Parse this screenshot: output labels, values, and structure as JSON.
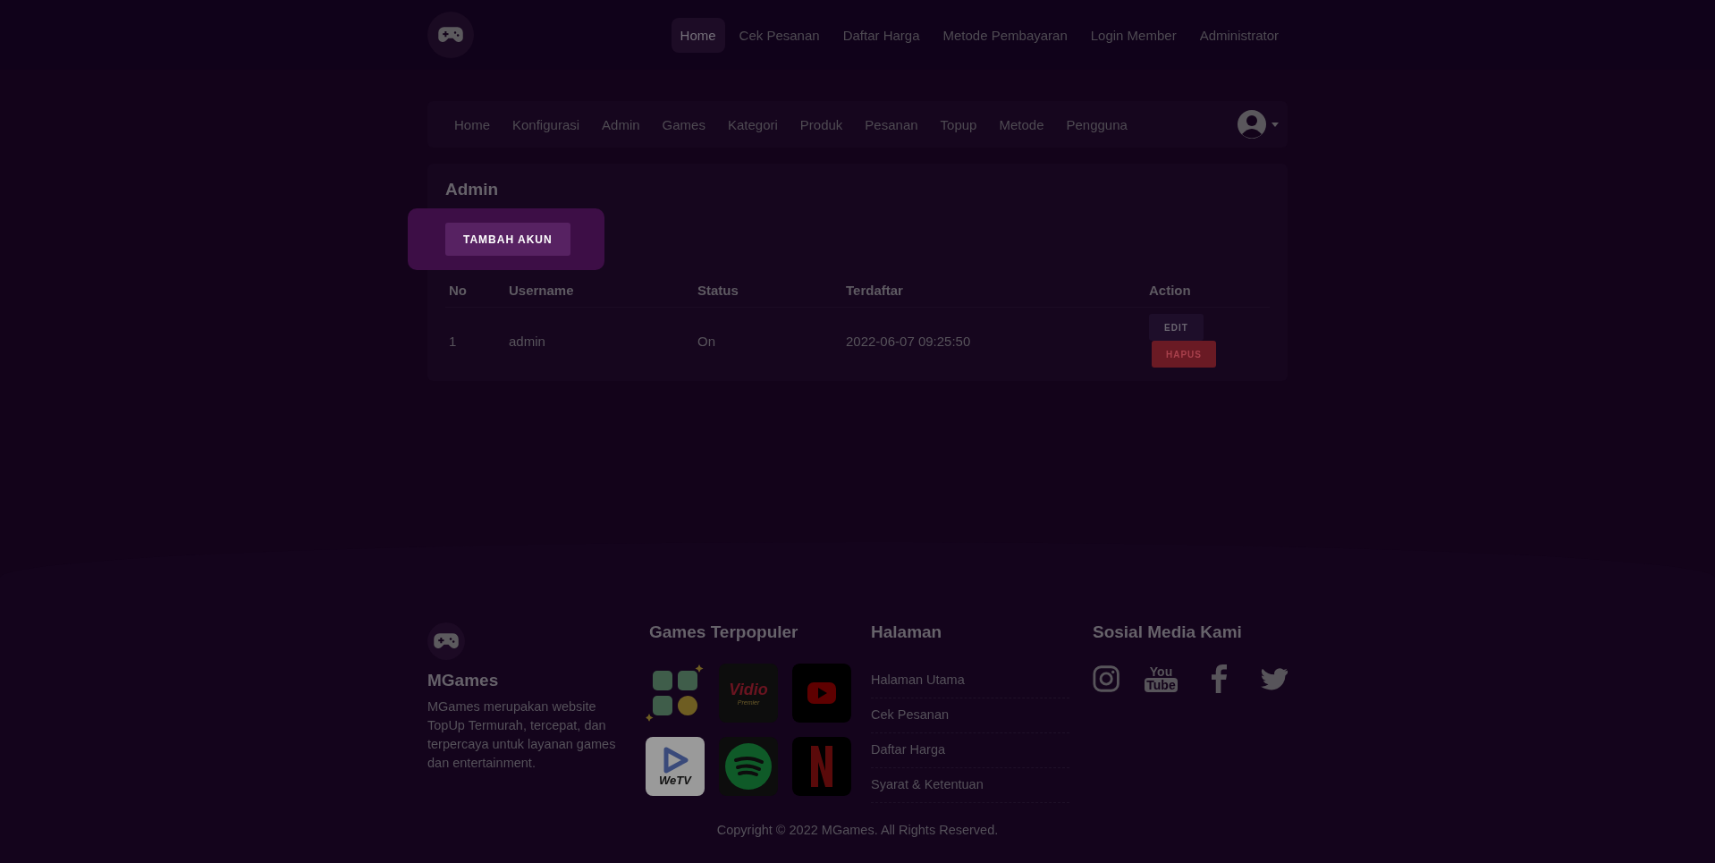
{
  "top_nav": {
    "items": [
      {
        "label": "Home",
        "selected": true
      },
      {
        "label": "Cek Pesanan",
        "selected": false
      },
      {
        "label": "Daftar Harga",
        "selected": false
      },
      {
        "label": "Metode Pembayaran",
        "selected": false
      },
      {
        "label": "Login Member",
        "selected": false
      },
      {
        "label": "Administrator",
        "selected": false
      }
    ]
  },
  "admin_nav": {
    "items": [
      {
        "label": "Home",
        "selected": false
      },
      {
        "label": "Konfigurasi",
        "selected": false
      },
      {
        "label": "Admin",
        "selected": false
      },
      {
        "label": "Games",
        "selected": false
      },
      {
        "label": "Kategori",
        "selected": false
      },
      {
        "label": "Produk",
        "selected": false
      },
      {
        "label": "Pesanan",
        "selected": false
      },
      {
        "label": "Topup",
        "selected": false
      },
      {
        "label": "Metode",
        "selected": false
      },
      {
        "label": "Pengguna",
        "selected": false
      }
    ]
  },
  "card": {
    "title": "Admin",
    "add_button": "TAMBAH AKUN",
    "table": {
      "columns": [
        "No",
        "Username",
        "Status",
        "Terdaftar",
        "Action"
      ],
      "rows": [
        {
          "no": "1",
          "username": "admin",
          "status": "On",
          "registered": "2022-06-07 09:25:50",
          "actions": [
            "EDIT",
            "HAPUS"
          ]
        }
      ]
    }
  },
  "footer": {
    "brand": "MGames",
    "description": "MGames merupakan website TopUp Termurah, tercepat, dan terpercaya untuk layanan games dan entertainment.",
    "games_title": "Games Terpopuler",
    "games": [
      {
        "kind": "coins"
      },
      {
        "kind": "vidio",
        "text": "Vidio",
        "subtext": "Premier"
      },
      {
        "kind": "youtube"
      },
      {
        "kind": "wetv",
        "text": "WeTV"
      },
      {
        "kind": "spotify"
      },
      {
        "kind": "netflix"
      }
    ],
    "pages_title": "Halaman",
    "pages": [
      "Halaman Utama",
      "Cek Pesanan",
      "Daftar Harga",
      "Syarat & Ketentuan"
    ],
    "social_title": "Sosial Media Kami",
    "social": [
      {
        "kind": "instagram"
      },
      {
        "kind": "youtube",
        "text": "You",
        "subtext": "Tube"
      },
      {
        "kind": "facebook"
      },
      {
        "kind": "twitter"
      }
    ],
    "copyright": "Copyright © 2022 MGames. All Rights Reserved."
  }
}
